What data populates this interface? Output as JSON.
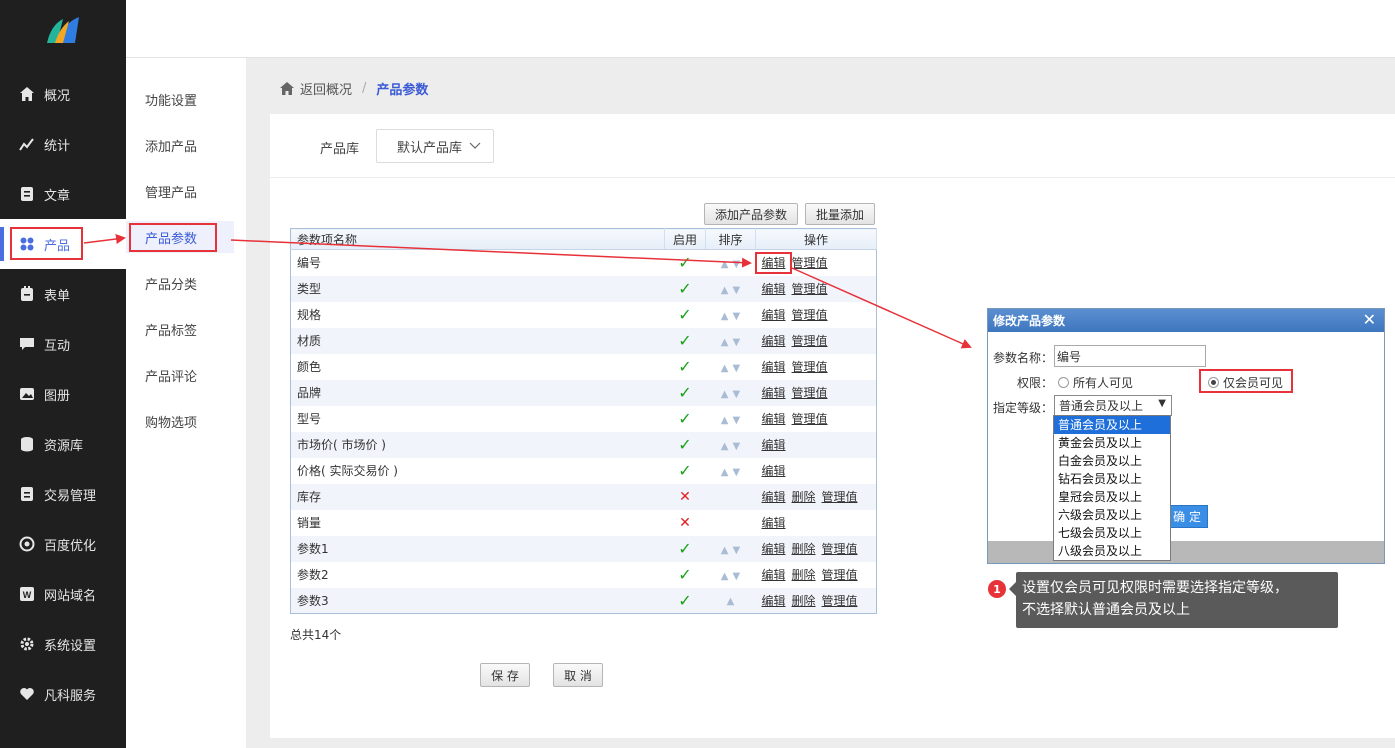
{
  "nav": {
    "items": [
      {
        "label": "概况",
        "icon": "home-icon"
      },
      {
        "label": "统计",
        "icon": "stats-icon"
      },
      {
        "label": "文章",
        "icon": "article-icon"
      },
      {
        "label": "产品",
        "icon": "product-icon"
      },
      {
        "label": "表单",
        "icon": "form-icon"
      },
      {
        "label": "互动",
        "icon": "chat-icon"
      },
      {
        "label": "图册",
        "icon": "album-icon"
      },
      {
        "label": "资源库",
        "icon": "database-icon"
      },
      {
        "label": "交易管理",
        "icon": "trade-icon"
      },
      {
        "label": "百度优化",
        "icon": "seo-icon"
      },
      {
        "label": "网站域名",
        "icon": "domain-icon"
      },
      {
        "label": "系统设置",
        "icon": "settings-icon"
      },
      {
        "label": "凡科服务",
        "icon": "heart-icon"
      }
    ],
    "active": "产品"
  },
  "subnav": {
    "items": [
      "功能设置",
      "添加产品",
      "管理产品",
      "产品参数",
      "产品分类",
      "产品标签",
      "产品评论",
      "购物选项"
    ],
    "active": "产品参数"
  },
  "breadcrumb": {
    "back": "返回概况",
    "sep": "/",
    "current": "产品参数"
  },
  "library": {
    "label": "产品库",
    "value": "默认产品库"
  },
  "toolbar": {
    "add_param": "添加产品参数",
    "batch_add": "批量添加"
  },
  "table": {
    "headers": {
      "name": "参数项名称",
      "enabled": "启用",
      "sort": "排序",
      "ops": "操作"
    },
    "rows": [
      {
        "name": "编号",
        "enabled": true,
        "sort": "both",
        "ops": [
          "编辑",
          "管理值"
        ]
      },
      {
        "name": "类型",
        "enabled": true,
        "sort": "both",
        "ops": [
          "编辑",
          "管理值"
        ]
      },
      {
        "name": "规格",
        "enabled": true,
        "sort": "both",
        "ops": [
          "编辑",
          "管理值"
        ]
      },
      {
        "name": "材质",
        "enabled": true,
        "sort": "both",
        "ops": [
          "编辑",
          "管理值"
        ]
      },
      {
        "name": "颜色",
        "enabled": true,
        "sort": "both",
        "ops": [
          "编辑",
          "管理值"
        ]
      },
      {
        "name": "品牌",
        "enabled": true,
        "sort": "both",
        "ops": [
          "编辑",
          "管理值"
        ]
      },
      {
        "name": "型号",
        "enabled": true,
        "sort": "both",
        "ops": [
          "编辑",
          "管理值"
        ]
      },
      {
        "name": "市场价( 市场价 )",
        "enabled": true,
        "sort": "both",
        "ops": [
          "编辑"
        ]
      },
      {
        "name": "价格( 实际交易价 )",
        "enabled": true,
        "sort": "both",
        "ops": [
          "编辑"
        ]
      },
      {
        "name": "库存",
        "enabled": false,
        "sort": "none",
        "ops": [
          "编辑",
          "删除",
          "管理值"
        ]
      },
      {
        "name": "销量",
        "enabled": false,
        "sort": "none",
        "ops": [
          "编辑"
        ]
      },
      {
        "name": "参数1",
        "enabled": true,
        "sort": "both",
        "ops": [
          "编辑",
          "删除",
          "管理值"
        ]
      },
      {
        "name": "参数2",
        "enabled": true,
        "sort": "both",
        "ops": [
          "编辑",
          "删除",
          "管理值"
        ]
      },
      {
        "name": "参数3",
        "enabled": true,
        "sort": "up",
        "ops": [
          "编辑",
          "删除",
          "管理值"
        ]
      }
    ],
    "total": "总共14个"
  },
  "actions": {
    "save": "保 存",
    "cancel": "取 消"
  },
  "dialog": {
    "title": "修改产品参数",
    "close": "✕",
    "name_label": "参数名称：",
    "name_value": "编号",
    "perm_label": "权限：",
    "perm_all": "所有人可见",
    "perm_member": "仅会员可见",
    "level_label": "指定等级：",
    "level_value": "普通会员及以上",
    "level_options": [
      "普通会员及以上",
      "黄金会员及以上",
      "白金会员及以上",
      "钻石会员及以上",
      "皇冠会员及以上",
      "六级会员及以上",
      "七级会员及以上",
      "八级会员及以上"
    ],
    "ok": "确 定"
  },
  "tip": {
    "number": "1",
    "line1": "设置仅会员可见权限时需要选择指定等级，",
    "line2": "不选择默认普通会员及以上"
  },
  "colors": {
    "accent": "#4a6ee0",
    "highlight": "#e8323a",
    "nav_bg": "#1f1f1f",
    "ok": "#18a318",
    "no": "#e02020"
  }
}
